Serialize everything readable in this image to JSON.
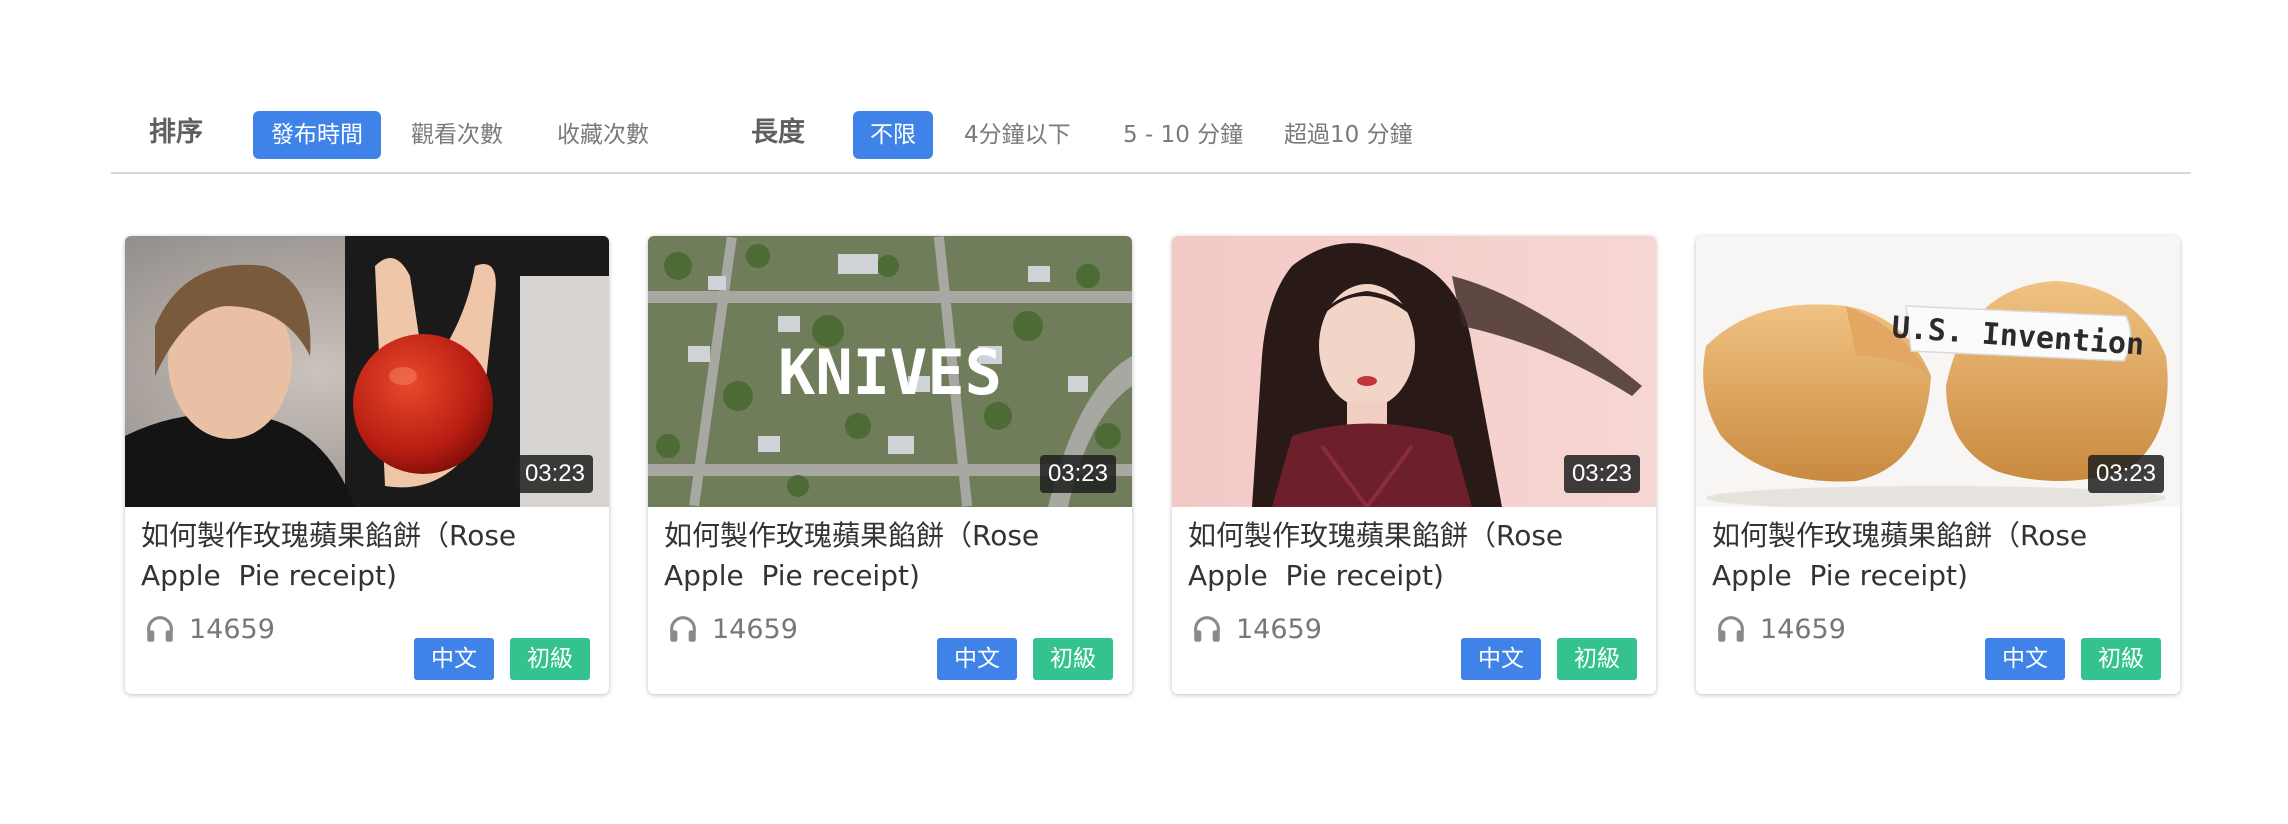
{
  "filters": {
    "sort_label": "排序",
    "sort_options": [
      "發布時間",
      "觀看次數",
      "收藏次數"
    ],
    "length_label": "長度",
    "length_options": [
      "不限",
      "4分鐘以下",
      "5 - 10 分鐘",
      "超過10 分鐘"
    ]
  },
  "colors": {
    "accent": "#3f83e8",
    "level_tag": "#34c38f"
  },
  "videos": [
    {
      "thumbnail_desc": "person holding red apple",
      "duration": "03:23",
      "title": "如何製作玫瑰蘋果餡餅（Rose Apple  Pie receipt)",
      "listens": "14659",
      "language": "中文",
      "level": "初級"
    },
    {
      "thumbnail_desc": "aerial suburb view",
      "thumbnail_text": "KNIVES",
      "duration": "03:23",
      "title": "如何製作玫瑰蘋果餡餅（Rose Apple  Pie receipt)",
      "listens": "14659",
      "language": "中文",
      "level": "初級"
    },
    {
      "thumbnail_desc": "woman on pink background",
      "duration": "03:23",
      "title": "如何製作玫瑰蘋果餡餅（Rose Apple  Pie receipt)",
      "listens": "14659",
      "language": "中文",
      "level": "初級"
    },
    {
      "thumbnail_desc": "fortune cookies",
      "thumbnail_text": "U.S. Invention",
      "duration": "03:23",
      "title": "如何製作玫瑰蘋果餡餅（Rose Apple  Pie receipt)",
      "listens": "14659",
      "language": "中文",
      "level": "初級"
    }
  ]
}
